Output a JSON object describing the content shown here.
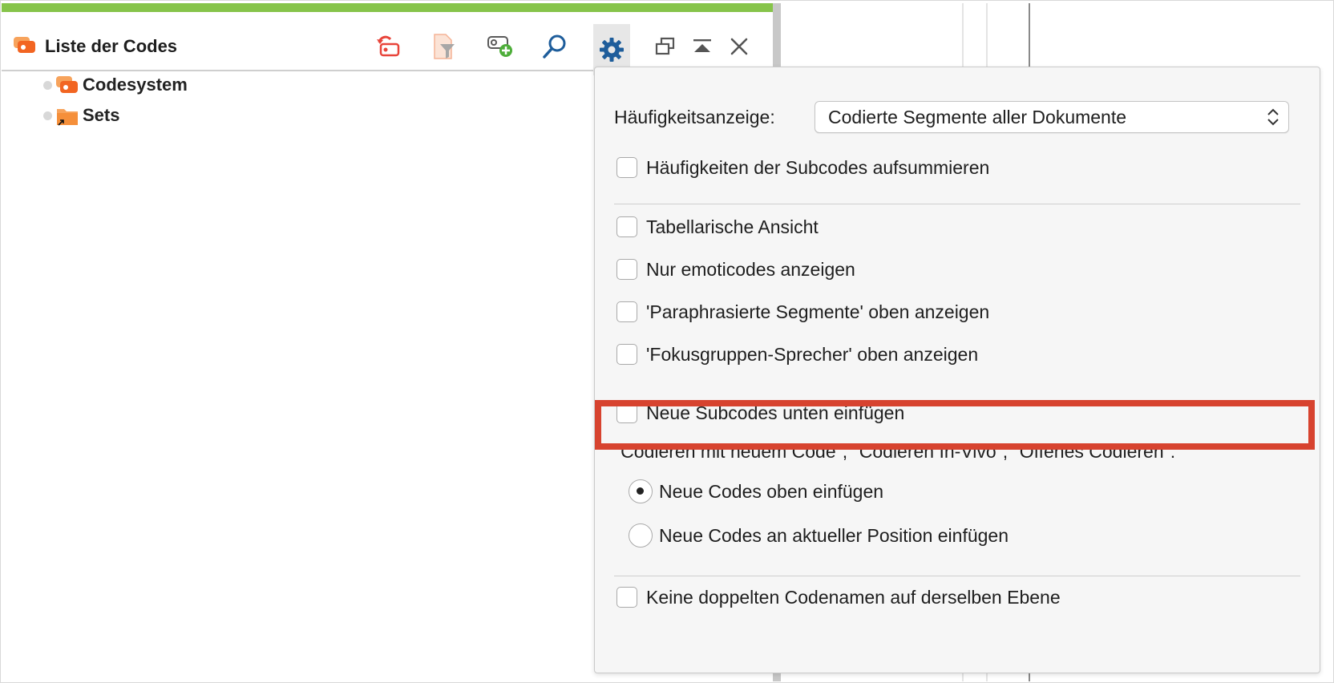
{
  "panel": {
    "title": "Liste der Codes",
    "toolbar": {
      "icons": [
        "code-reset-icon",
        "filter-document-icon",
        "new-code-icon",
        "search-icon",
        "gear-icon",
        "undock-icon",
        "collapse-icon",
        "close-icon"
      ]
    },
    "tree": [
      {
        "label": "Codesystem",
        "icon": "code-icon"
      },
      {
        "label": "Sets",
        "icon": "folder-shortcut-icon"
      }
    ]
  },
  "settings": {
    "frequency_label": "Häufigkeitsanzeige:",
    "frequency_value": "Codierte Segmente aller Dokumente",
    "sum_subcodes": "Häufigkeiten der Subcodes aufsummieren",
    "options": {
      "table_view": "Tabellarische Ansicht",
      "only_emoticodes": "Nur emoticodes anzeigen",
      "paraphrased_top": "'Paraphrasierte Segmente' oben anzeigen",
      "focus_group_top": "'Fokusgruppen-Sprecher' oben anzeigen"
    },
    "new_subcodes_bottom": "Neue Subcodes unten einfügen",
    "coding_heading": "\"Codieren mit neuem Code\", \"Codieren In-Vivo\", \"Offenes Codieren\":",
    "radio_top": "Neue Codes oben einfügen",
    "radio_current": "Neue Codes an aktueller Position einfügen",
    "no_duplicates": "Keine doppelten Codenamen auf derselben Ebene"
  },
  "colors": {
    "accent_green": "#86c44a",
    "highlight_red": "#d7432f",
    "code_orange": "#f26522",
    "gear_blue": "#1e5d9b"
  }
}
